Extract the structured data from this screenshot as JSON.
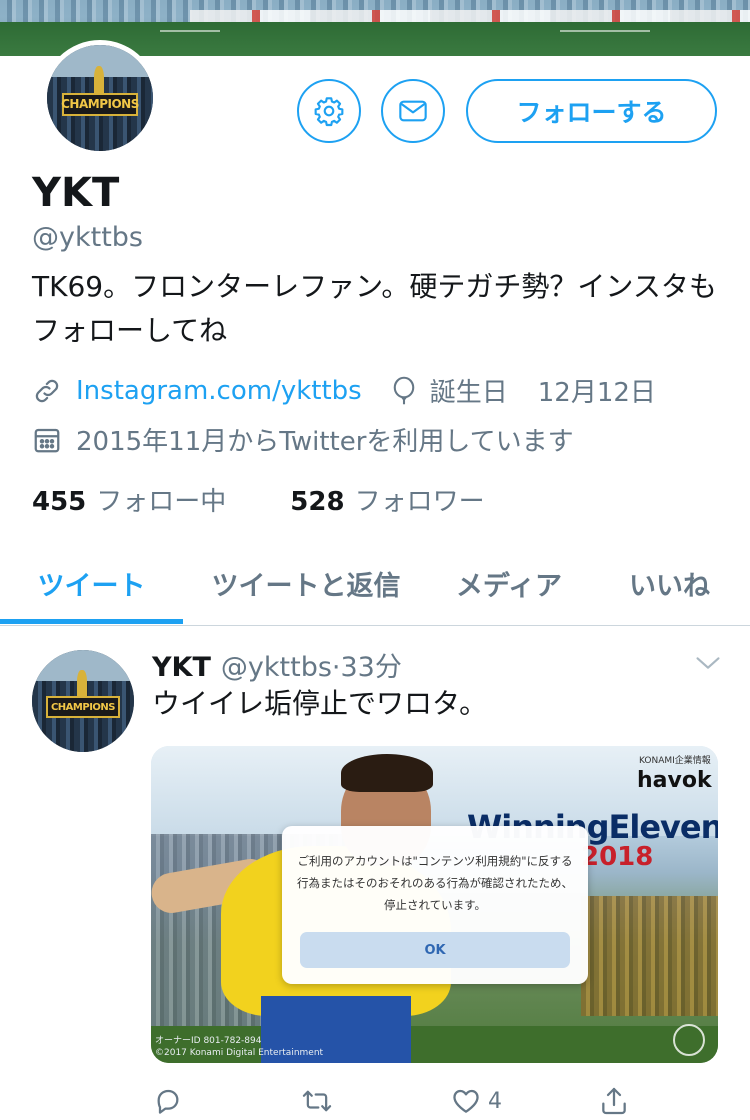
{
  "profile": {
    "name": "YKT",
    "handle": "@ykttbs",
    "bio": "TK69。フロンターレファン。硬テガチ勢？インスタもフォローしてね",
    "avatar_board_text": "CHAMPIONS",
    "follow_label": "フォローする",
    "link": "Instagram.com/ykttbs",
    "birthday_label": "誕生日",
    "birthday_value": "12月12日",
    "joined": "2015年11月からTwitterを利用しています",
    "following_count": "455",
    "following_label": "フォロー中",
    "followers_count": "528",
    "followers_label": "フォロワー"
  },
  "tabs": [
    {
      "label": "ツイート",
      "active": true
    },
    {
      "label": "ツイートと返信",
      "active": false
    },
    {
      "label": "メディア",
      "active": false
    },
    {
      "label": "いいね",
      "active": false
    }
  ],
  "tweet": {
    "name": "YKT",
    "handle": "@ykttbs",
    "separator": "·",
    "time": "33分",
    "text": "ウイイレ垢停止でワロタ。",
    "like_count": "4",
    "media": {
      "brand": "KONAMI企業情報",
      "logo": "havok",
      "game_title": "WinningEleven",
      "game_number": "2018",
      "owner_id": "オーナーID 801-782-894",
      "copyright": "©2017 Konami Digital Entertainment",
      "dialog_message": "ご利用のアカウントは\"コンテンツ利用規約\"に反する行為またはそのおそれのある行為が確認されたため、停止されています。",
      "dialog_ok": "OK"
    }
  },
  "colors": {
    "accent": "#1da1f2",
    "text_primary": "#14171a",
    "text_secondary": "#657786",
    "divider": "#ccd6dd"
  },
  "icons": {
    "settings": "gear-icon",
    "message": "envelope-icon",
    "link": "link-icon",
    "birthday": "balloon-icon",
    "joined": "calendar-icon",
    "caret": "chevron-down-icon",
    "reply": "reply-icon",
    "retweet": "retweet-icon",
    "like": "heart-icon",
    "share": "share-icon"
  }
}
